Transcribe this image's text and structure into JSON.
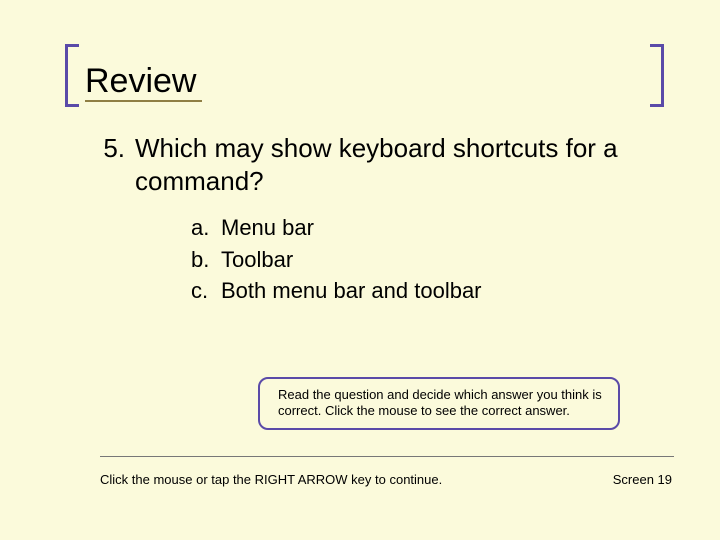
{
  "title": "Review",
  "question": {
    "number": "5.",
    "text": "Which may show keyboard shortcuts for a command?",
    "options": [
      {
        "letter": "a.",
        "text": "Menu bar"
      },
      {
        "letter": "b.",
        "text": "Toolbar"
      },
      {
        "letter": "c.",
        "text": "Both menu bar and toolbar"
      }
    ]
  },
  "hint": "Read the question and decide which answer you think is correct. Click the mouse to see the correct answer.",
  "footer": {
    "left": "Click the mouse or tap the RIGHT ARROW key to continue.",
    "right": "Screen 19"
  }
}
